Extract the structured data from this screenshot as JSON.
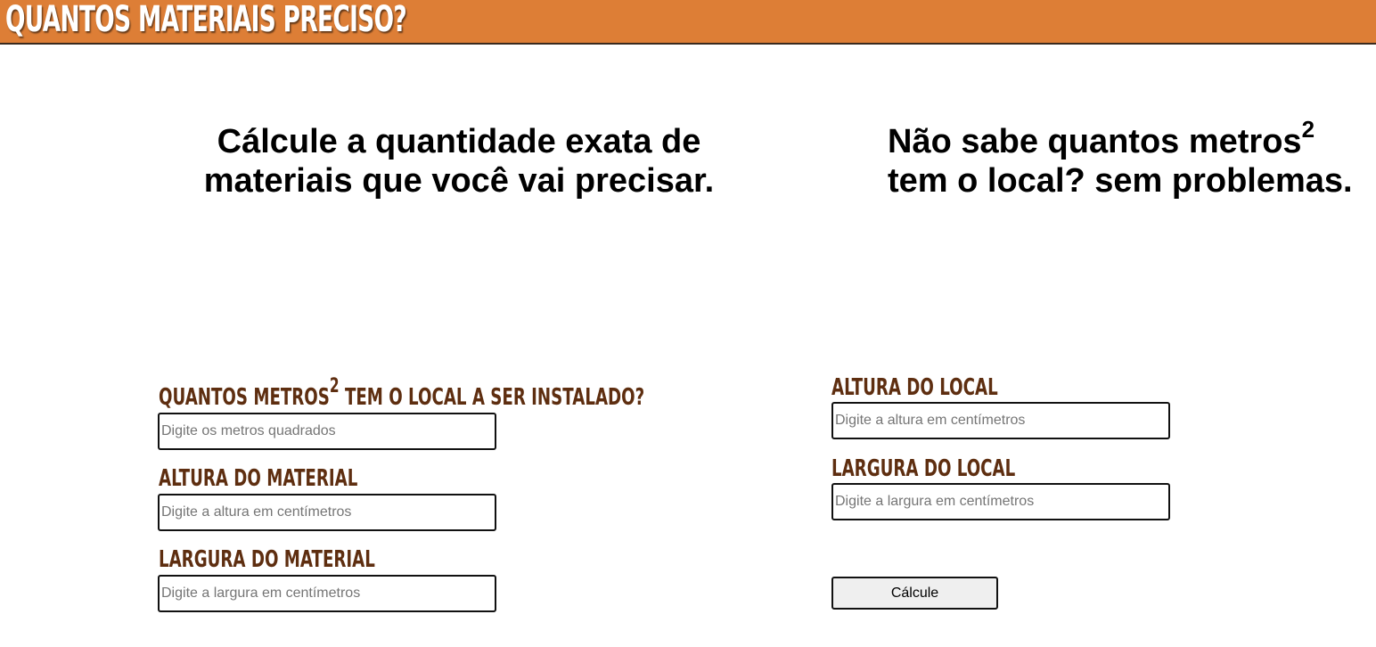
{
  "header": {
    "title": "Quantos materiais preciso?",
    "background_color": "#dd7e36"
  },
  "headlines": {
    "left": {
      "line1": "Cálcule a quantidade exata de",
      "line2": "materiais que você vai precisar."
    },
    "right": {
      "line1_text": "Não sabe quantos metros",
      "line1_sup": "2",
      "line2": "tem o local? sem problemas."
    }
  },
  "form_left": {
    "square_meters": {
      "label_prefix": "Quantos metros",
      "label_sup": "2",
      "label_suffix": " tem o local a ser instalado?",
      "placeholder": "Digite os metros quadrados",
      "value": ""
    },
    "material_height": {
      "label": "Altura do material",
      "placeholder": "Digite a altura em centímetros",
      "value": ""
    },
    "material_width": {
      "label": "Largura do material",
      "placeholder": "Digite a largura em centímetros",
      "value": ""
    }
  },
  "form_right": {
    "local_height": {
      "label": "Altura do local",
      "placeholder": "Digite a altura em centímetros",
      "value": ""
    },
    "local_width": {
      "label": "Largura do local",
      "placeholder": "Digite a largura em centímetros",
      "value": ""
    },
    "submit_label": "Cálcule"
  },
  "colors": {
    "label_brown": "#5e2e10",
    "header_orange": "#dd7e36"
  }
}
